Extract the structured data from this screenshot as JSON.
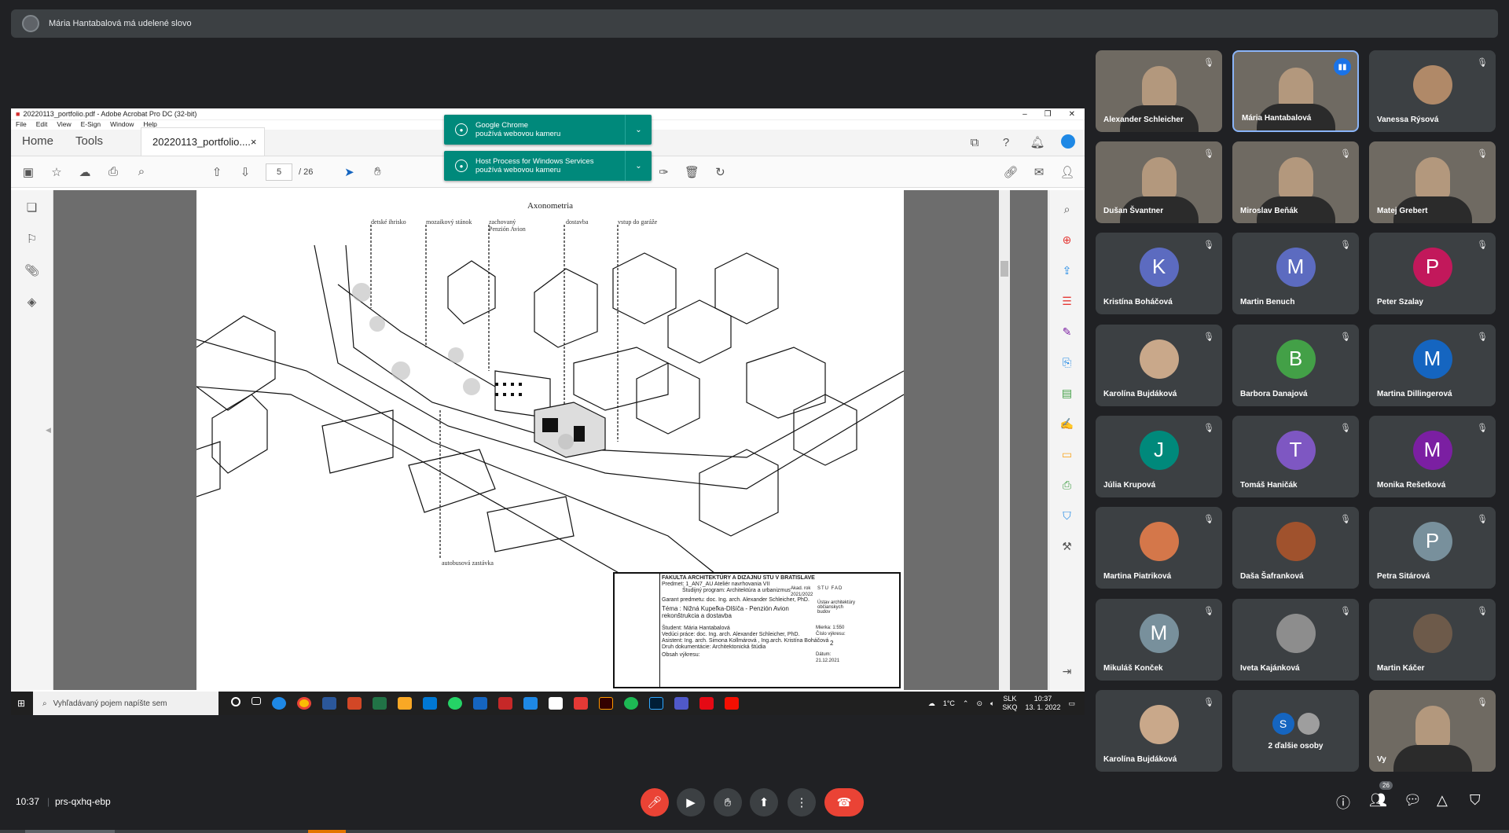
{
  "presenter_notice": "Mária Hantabalová má udelené slovo",
  "acrobat": {
    "window_title": "20220113_portfolio.pdf - Adobe Acrobat Pro DC (32-bit)",
    "menu": [
      "File",
      "Edit",
      "View",
      "E-Sign",
      "Window",
      "Help"
    ],
    "tab_home": "Home",
    "tab_tools": "Tools",
    "doc_tab": "20220113_portfolio....",
    "doc_tab_close": "×",
    "page_current": "5",
    "page_total": "/ 26",
    "page": {
      "title": "Axonometria",
      "labels": [
        "detské ihrisko",
        "mozaikový stánok",
        "zachovaný Penzión Avion",
        "dostavba",
        "vstup do garáže",
        "autobusová zastávka"
      ],
      "stamp": {
        "school": "FAKULTA ARCHITEKTÚRY A DIZAJNU STU V BRATISLAVE",
        "subject": "Predmet: 1_AN7_AU Ateliér navrhovania VII",
        "program": "Študijný program: Architektúra a urbanizmus",
        "guarantor": "Garant predmetu: doc. Ing. arch. Alexander Schleicher, PhD.",
        "topic": "Téma : Nižná Kupeľka-Dlšíča - Penzión Avion rekonštrukcia a dostavba",
        "student": "Študent: Mária Hantabalová",
        "lead": "Vedúci práce: doc. Ing. arch. Alexander Schleicher, PhD.",
        "assistant": "Asistent: Ing. arch. Simona Kollmárová , Ing.arch. Kristína Boháčová",
        "doc_type": "Druh dokumentácie: Architektonická štúdia",
        "content": "Obsah výkresu:",
        "year_label": "Akad. rok",
        "year": "2021/2022",
        "institute": "Ústav architektúry občianskych budov",
        "scale": "Mierka: 1:550",
        "drawing_no_label": "Číslo výkresu:",
        "drawing_no": "2",
        "date_label": "Dátum:",
        "date": "21.12.2021",
        "logo": "STU FAD"
      }
    }
  },
  "notifications": [
    {
      "app": "Google Chrome",
      "text": "používá webovou kameru"
    },
    {
      "app": "Host Process for Windows Services",
      "text": "používá webovou kameru"
    }
  ],
  "taskbar": {
    "search_placeholder": "Vyhľadávaný pojem napíšte sem",
    "weather": "1°C",
    "lang1": "SLK",
    "lang2": "SKQ",
    "clock_time": "10:37",
    "clock_date": "13. 1. 2022"
  },
  "participants": [
    {
      "name": "Alexander Schleicher",
      "type": "video"
    },
    {
      "name": "Mária Hantabalová",
      "type": "video",
      "active": true
    },
    {
      "name": "Vanessa Rýsová",
      "type": "photo",
      "color": "#b08968"
    },
    {
      "name": "Dušan Švantner",
      "type": "video"
    },
    {
      "name": "Miroslav Beňák",
      "type": "video"
    },
    {
      "name": "Matej Grebert",
      "type": "video"
    },
    {
      "name": "Kristína Boháčová",
      "letter": "K",
      "color": "#5c6bc0"
    },
    {
      "name": "Martin Benuch",
      "letter": "M",
      "color": "#5c6bc0"
    },
    {
      "name": "Peter Szalay",
      "letter": "P",
      "color": "#c2185b"
    },
    {
      "name": "Karolína Bujdáková",
      "type": "photo",
      "color": "#c9a88a"
    },
    {
      "name": "Barbora Danajová",
      "letter": "B",
      "color": "#43a047"
    },
    {
      "name": "Martina Dillingerová",
      "letter": "M",
      "color": "#1565c0"
    },
    {
      "name": "Júlia Krupová",
      "letter": "J",
      "color": "#00897b"
    },
    {
      "name": "Tomáš Haničák",
      "letter": "T",
      "color": "#7e57c2"
    },
    {
      "name": "Monika Rešetková",
      "letter": "M",
      "color": "#7b1fa2"
    },
    {
      "name": "Martina Piatriková",
      "type": "photo",
      "color": "#d4774a"
    },
    {
      "name": "Daša Šafranková",
      "type": "photo",
      "color": "#a0522d"
    },
    {
      "name": "Petra Sitárová",
      "letter": "P",
      "color": "#78909c"
    },
    {
      "name": "Mikuláš Konček",
      "letter": "M",
      "color": "#78909c"
    },
    {
      "name": "Iveta Kajánková",
      "type": "photo",
      "color": "#8d8d8d"
    },
    {
      "name": "Martin Káčer",
      "type": "photo",
      "color": "#6d5a4a"
    },
    {
      "name": "Karolína Bujdáková",
      "type": "photo",
      "color": "#c9a88a"
    },
    {
      "name": "2 ďalšie osoby",
      "type": "more"
    },
    {
      "name": "Vy",
      "type": "video"
    }
  ],
  "more_letter": "S",
  "meeting": {
    "time": "10:37",
    "separator": "|",
    "code": "prs-qxhq-ebp",
    "people_count": "26"
  }
}
